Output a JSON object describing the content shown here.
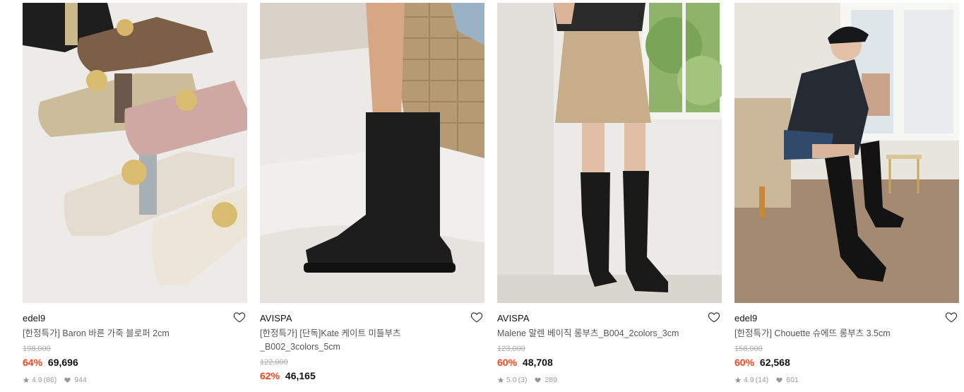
{
  "products": [
    {
      "brand": "edel9",
      "title": "[한정특가] Baron 바른 가죽 블로퍼 2cm",
      "original_price": "198,000",
      "discount": "64%",
      "price": "69,696",
      "rating": "4.9",
      "review_count": "(86)",
      "likes": "944",
      "image": "loafer-mules"
    },
    {
      "brand": "AVISPA",
      "title": "[한정특가] [단독]Kate 케이트 미들부츠 _B002_3colors_5cm",
      "original_price": "122,000",
      "discount": "62%",
      "price": "46,165",
      "rating": "",
      "review_count": "",
      "likes": "",
      "image": "black-middle-boots"
    },
    {
      "brand": "AVISPA",
      "title": "Malene 말렌 베이직 롱부츠_B004_2colors_3cm",
      "original_price": "123,000",
      "discount": "60%",
      "price": "48,708",
      "rating": "5.0",
      "review_count": "(3)",
      "likes": "289",
      "image": "black-long-boots"
    },
    {
      "brand": "edel9",
      "title": "[한정특가] Chouette 슈에뜨 롱부츠 3.5cm",
      "original_price": "158,000",
      "discount": "60%",
      "price": "62,568",
      "rating": "4.9",
      "review_count": "(14)",
      "likes": "601",
      "image": "model-long-boots"
    }
  ],
  "colors": {
    "discount": "#f0471f",
    "muted": "#999999",
    "brand_text": "#111111"
  },
  "icons": {
    "wishlist": "heart-outline-icon",
    "rating": "star-icon",
    "likes": "heart-filled-icon"
  }
}
